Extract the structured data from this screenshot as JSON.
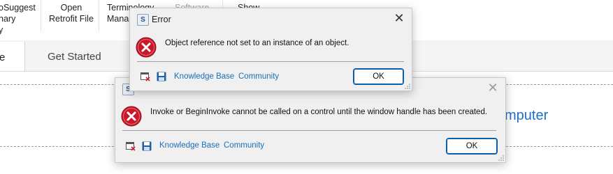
{
  "ribbon": {
    "items": [
      {
        "line1": "oSuggest",
        "line2": "nary",
        "line3": "y"
      },
      {
        "line1": "Open",
        "line2": "Retrofit File"
      },
      {
        "line1": "Terminology",
        "line2": "Mana"
      },
      {
        "line1": "Software",
        "line2": ""
      },
      {
        "line1": "Show",
        "line2": ""
      }
    ]
  },
  "tabs": {
    "active_label": "e",
    "get_started": "Get Started"
  },
  "background_text": "mputer",
  "dialog1": {
    "title": "Error",
    "message": "Object reference not set to an instance of an object.",
    "links": [
      "Knowledge Base",
      "Community"
    ],
    "ok_label": "OK",
    "icon": "error-icon"
  },
  "dialog2": {
    "title": "",
    "message": "Invoke or BeginInvoke cannot be called on a control until the window handle has been created.",
    "links": [
      "Knowledge Base",
      "Community"
    ],
    "ok_label": "OK",
    "icon": "error-icon"
  },
  "app_icon_letter": "S",
  "colors": {
    "accent": "#0b5cad",
    "link": "#1a6fb8",
    "error_red": "#c8192b",
    "dialog_bg": "#f0f0f0"
  }
}
